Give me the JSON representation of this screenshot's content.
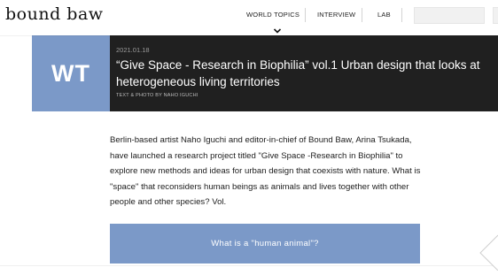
{
  "header": {
    "logo_text": "bound baw",
    "nav": [
      {
        "label": "WORLD TOPICS"
      },
      {
        "label": "INTERVIEW"
      },
      {
        "label": "LAB"
      }
    ],
    "active_nav": "WORLD TOPICS",
    "search_placeholder": ""
  },
  "hero": {
    "badge": "WT",
    "date": "2021.01.18",
    "title": "“Give Space - Research in Biophilia” vol.1 Urban design that looks at heterogeneous living territories",
    "credit": "TEXT & PHOTO BY NAHO IGUCHI"
  },
  "article": {
    "lede": "Berlin-based artist Naho Iguchi and editor-in-chief of Bound Baw, Arina Tsukada, have launched a research project titled \"Give Space -Research in Biophilia\" to explore new methods and ideas for urban design that coexists with nature. What is \"space\" that reconsiders human beings as animals and lives together with other people and other species? Vol.",
    "section_heading": "What is a \"human animal\"?"
  },
  "colors": {
    "accent_blue": "#7b99c8",
    "hero_bg": "#202020"
  },
  "icons": [
    "chevron-down-icon",
    "page-flip-icon"
  ]
}
